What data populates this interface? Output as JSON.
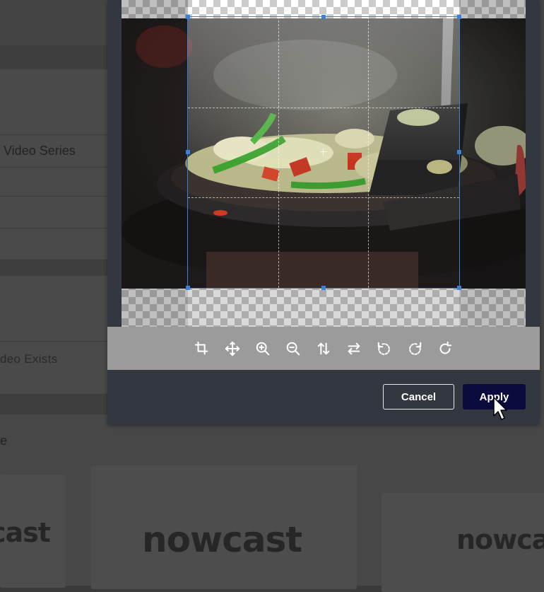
{
  "background": {
    "rows": [
      "Video Series",
      "deo Exists"
    ],
    "section_fragment": "e",
    "cards": [
      "now",
      "cast"
    ]
  },
  "cropper": {
    "toolbar_tools": [
      {
        "name": "crop-icon",
        "label": "Crop"
      },
      {
        "name": "move-icon",
        "label": "Move"
      },
      {
        "name": "zoom-in-icon",
        "label": "Zoom in"
      },
      {
        "name": "zoom-out-icon",
        "label": "Zoom out"
      },
      {
        "name": "flip-vertical-icon",
        "label": "Flip vertical"
      },
      {
        "name": "flip-horizontal-icon",
        "label": "Flip horizontal"
      },
      {
        "name": "rotate-left-icon",
        "label": "Rotate left"
      },
      {
        "name": "rotate-right-icon",
        "label": "Rotate right"
      },
      {
        "name": "reset-icon",
        "label": "Reset"
      }
    ]
  },
  "footer": {
    "cancel_label": "Cancel",
    "apply_label": "Apply"
  },
  "colors": {
    "accent": "#3b82d6",
    "apply_bg": "#0a0a3c",
    "toolbar_bg": "#9b9b9b",
    "modal_bg": "#333740"
  }
}
